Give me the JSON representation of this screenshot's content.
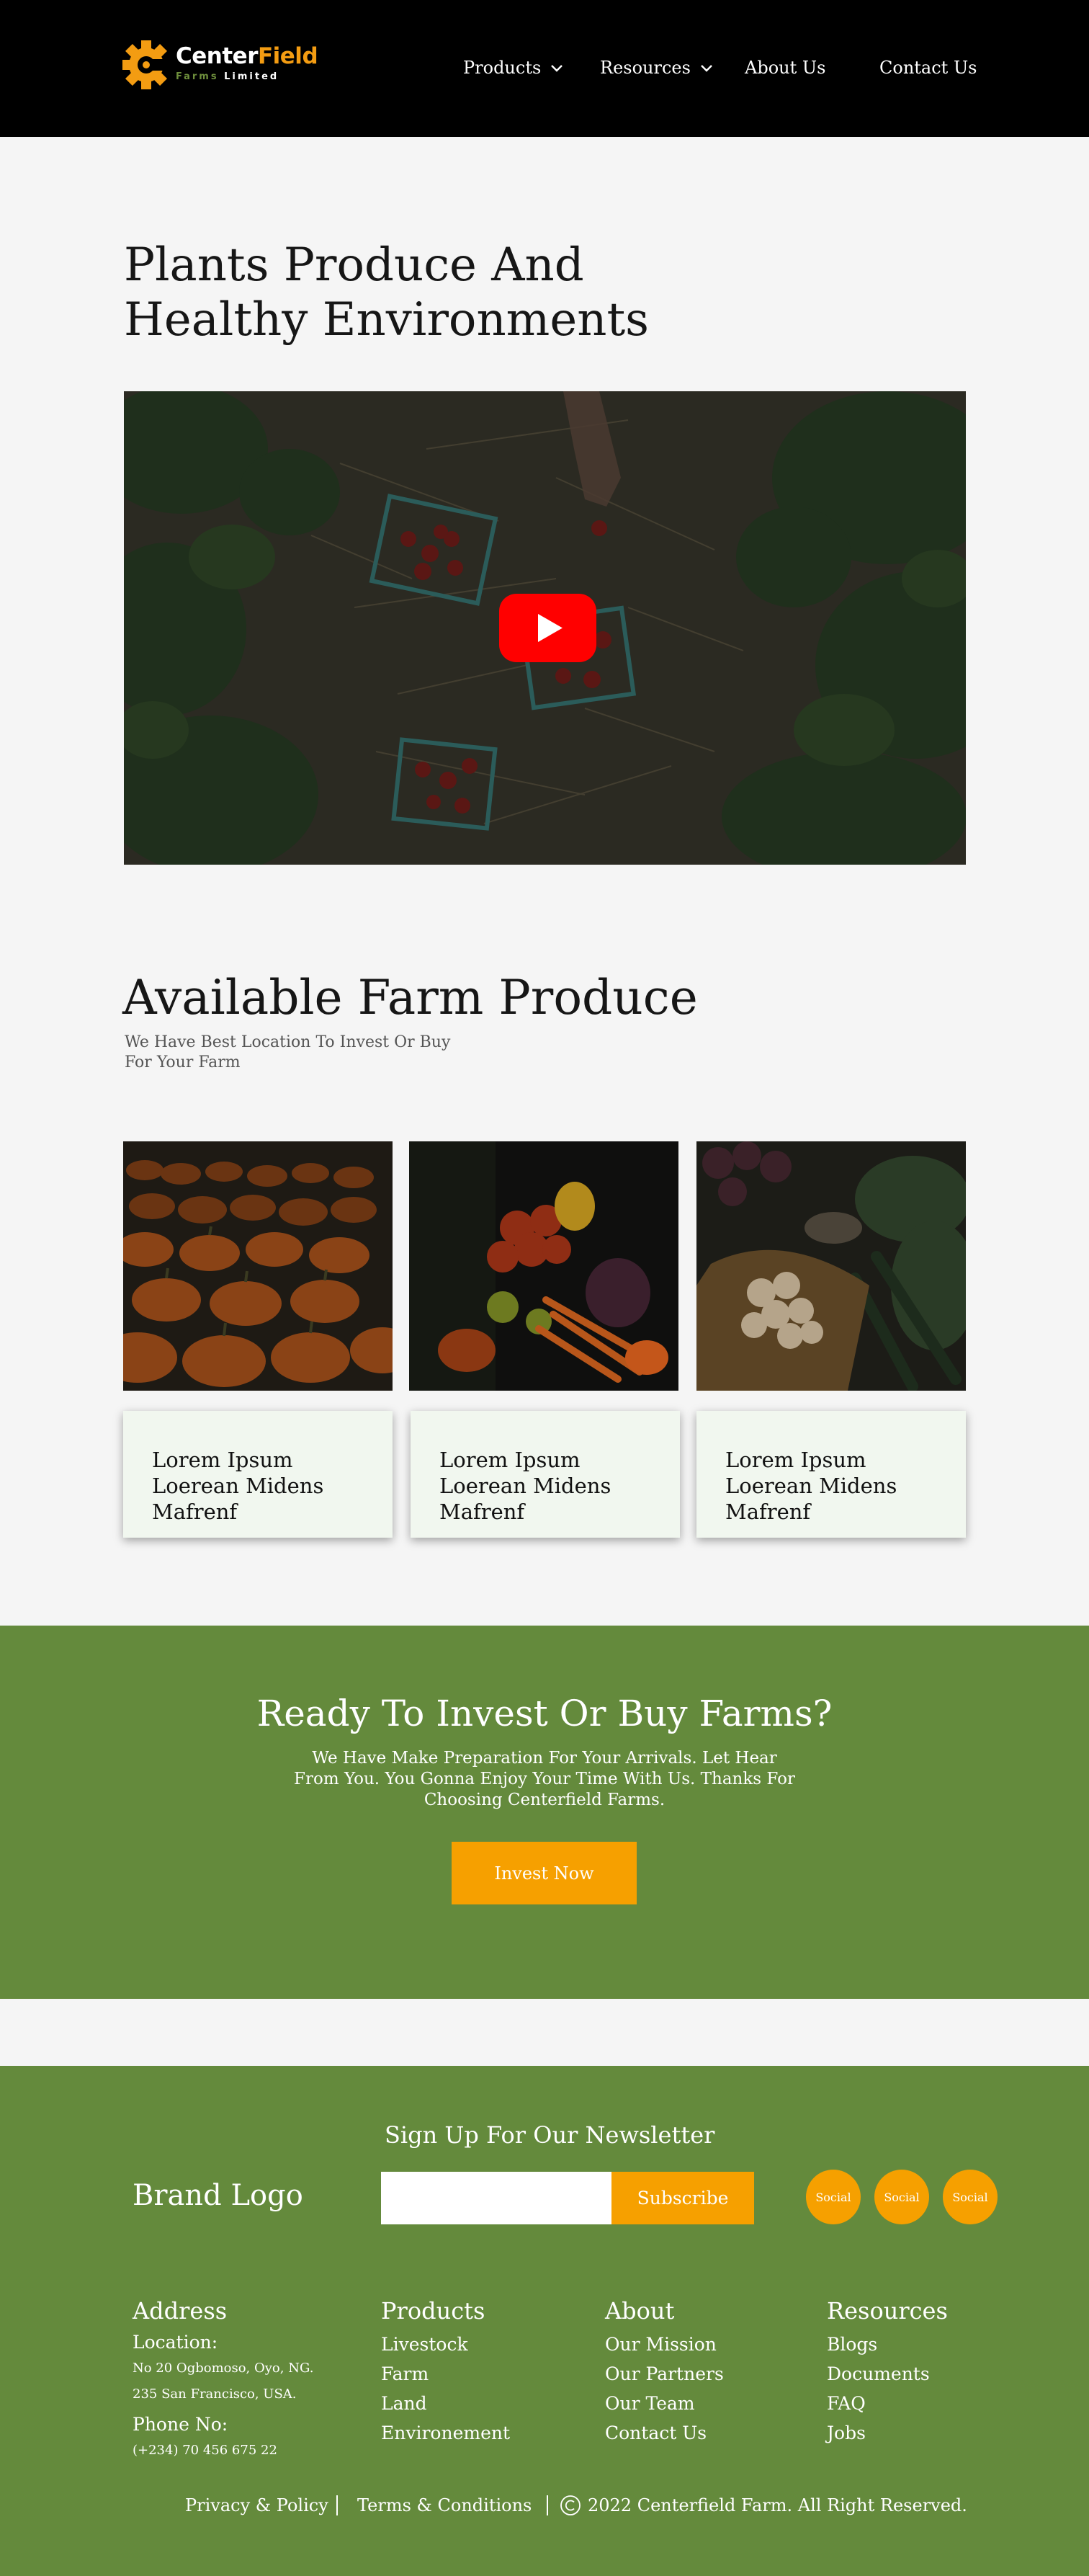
{
  "colors": {
    "header_bg": "#000000",
    "accent_orange": "#f6a000",
    "brand_green": "#648a3c",
    "page_bg": "#f5f5f5",
    "card_bg": "#f1f7ef"
  },
  "header": {
    "logo": {
      "name_part1": "Center",
      "name_part2": "Field",
      "sub_part1": "Farms",
      "sub_part2": "Limited"
    },
    "nav": [
      {
        "label": "Products",
        "icon": "chevron-down-icon"
      },
      {
        "label": "Resources",
        "icon": "chevron-down-icon"
      },
      {
        "label": "About Us"
      },
      {
        "label": "Contact Us"
      }
    ]
  },
  "hero": {
    "title_line1": "Plants Produce And",
    "title_line2": "Healthy Environments",
    "video_play_icon": "youtube-play-icon"
  },
  "produce": {
    "title": "Available Farm Produce",
    "subtitle": "We Have Best Location To Invest Or Buy For Your Farm",
    "cards": [
      {
        "image": "pumpkins",
        "text": "Lorem Ipsum Loerean Midens Mafrenf"
      },
      {
        "image": "vegetables",
        "text": "Lorem Ipsum Loerean Midens Mafrenf"
      },
      {
        "image": "garlic-market",
        "text": "Lorem Ipsum Loerean Midens Mafrenf"
      }
    ]
  },
  "cta": {
    "title": "Ready To Invest Or Buy Farms?",
    "text": "We Have Make Preparation For Your Arrivals. Let Hear From You. You Gonna Enjoy Your Time With Us. Thanks For Choosing Centerfield Farms.",
    "button": "Invest Now"
  },
  "footer": {
    "brand_logo": "Brand Logo",
    "newsletter": {
      "title": "Sign Up For Our Newsletter",
      "placeholder": "",
      "button": "Subscribe"
    },
    "social": [
      "Social",
      "Social",
      "Social"
    ],
    "address": {
      "title": "Address",
      "location_label": "Location:",
      "location_line1": "No 20 Ogbomoso, Oyo, NG.",
      "location_line2": "235 San Francisco, USA.",
      "phone_label": "Phone No:",
      "phone": "(+234) 70 456 675 22"
    },
    "columns": [
      {
        "title": "Products",
        "links": [
          "Livestock",
          "Farm",
          "Land",
          "Environement"
        ]
      },
      {
        "title": "About",
        "links": [
          "Our Mission",
          "Our Partners",
          "Our Team",
          "Contact Us"
        ]
      },
      {
        "title": "Resources",
        "links": [
          "Blogs",
          "Documents",
          "FAQ",
          "Jobs"
        ]
      }
    ],
    "bottom": {
      "privacy": "Privacy & Policy",
      "terms": "Terms & Conditions",
      "copyright_icon": "copyright-icon",
      "copyright": "2022 Centerfield Farm. All Right Reserved."
    }
  }
}
